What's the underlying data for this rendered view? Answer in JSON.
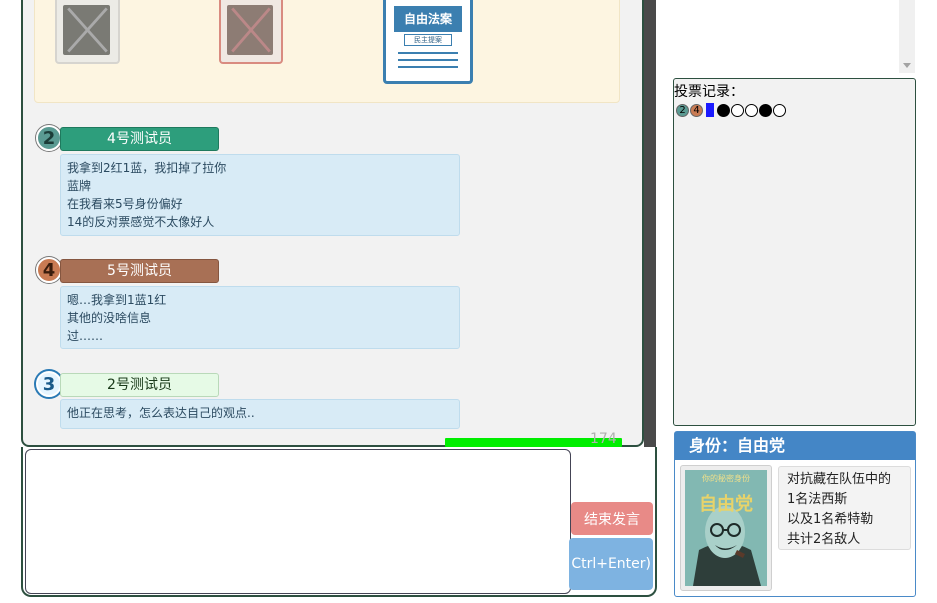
{
  "policy_cards": {
    "new_card_title": "自由法案",
    "new_card_sub": "民主提案"
  },
  "speakers": [
    {
      "seat": "2",
      "name": "4号测试员",
      "seat_color": "#5a9a92",
      "bar_color": "#2d9e7c",
      "lines": [
        "我拿到2红1蓝，我扣掉了拉你",
        "蓝牌",
        "在我看来5号身份偏好",
        "14的反对票感觉不太像好人"
      ]
    },
    {
      "seat": "4",
      "name": "5号测试员",
      "seat_color": "#c97b53",
      "bar_color": "#a87055",
      "lines": [
        "嗯…我拿到1蓝1红",
        "其他的没啥信息",
        "过……"
      ]
    },
    {
      "seat": "3",
      "name": "2号测试员",
      "seat_color": "#e6f5ff",
      "bar_color": "#e6fae6",
      "lines": [
        "他正在思考，怎么表达自己的观点.."
      ]
    }
  ],
  "progress": {
    "label": "174",
    "fraction": 1.0
  },
  "input": {
    "placeholder": "",
    "end_speech_label": "结束发言",
    "send_label": "Ctrl+Enter)"
  },
  "vote_record": {
    "title": "投票记录：",
    "seats": [
      {
        "label": "2",
        "color": "#5a9a92"
      },
      {
        "label": "4",
        "color": "#c97b53"
      }
    ],
    "bar_color": "#1a1aff",
    "votes": [
      "filled",
      "empty",
      "empty",
      "filled",
      "empty"
    ]
  },
  "identity": {
    "header": "身份：自由党",
    "card_top": "你的秘密身份",
    "card_label": "自由党",
    "description": [
      "对抗藏在队伍中的",
      "1名法西斯",
      "以及1名希特勒",
      "共计2名敌人"
    ]
  }
}
